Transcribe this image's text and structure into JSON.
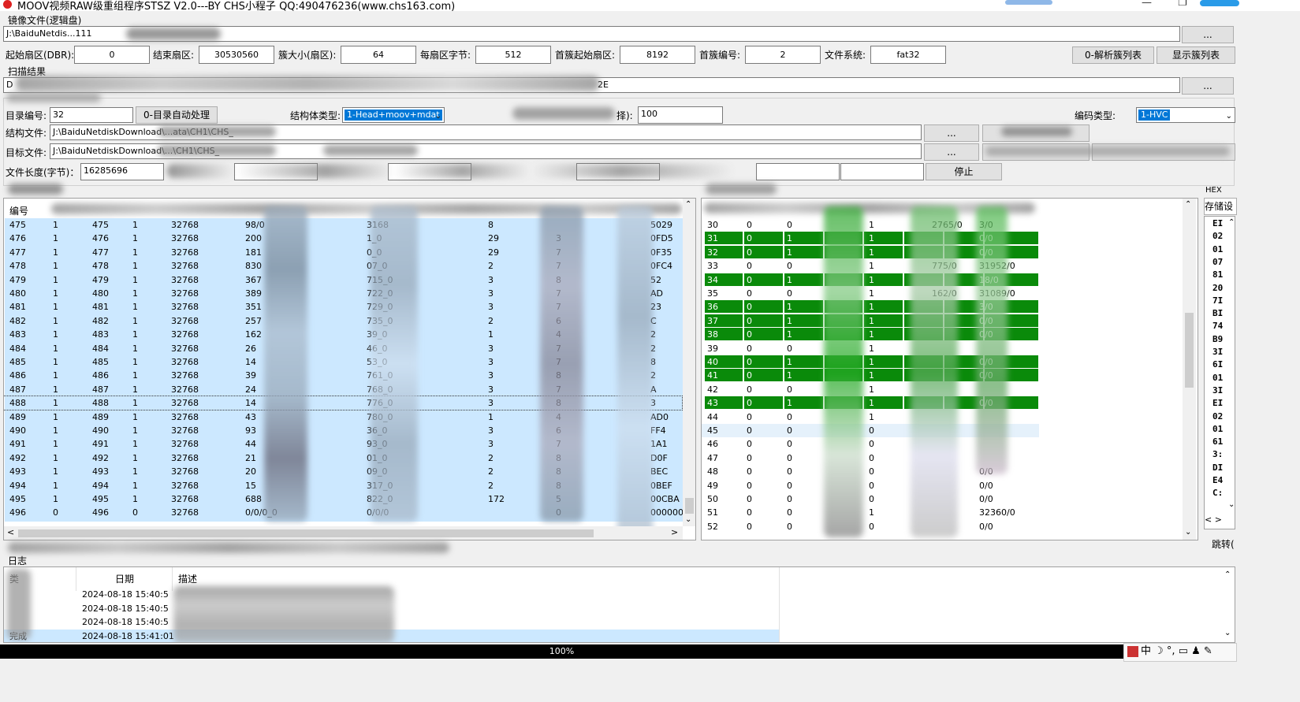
{
  "window": {
    "title": "MOOV视频RAW级重组程序STSZ V2.0---BY CHS小程子  QQ:490476236(www.chs163.com)",
    "minimize": "—",
    "restore": "❐",
    "close": "✕"
  },
  "image_group": {
    "label": "镜像文件(逻辑盘)",
    "path": "J:\\BaiduNetdis...111",
    "browse": "..."
  },
  "params": {
    "start_sector_label": "起始扇区(DBR):",
    "start_sector": "0",
    "end_sector_label": "结束扇区:",
    "end_sector": "30530560",
    "cluster_size_label": "簇大小(扇区):",
    "cluster_size": "64",
    "bytes_per_sector_label": "每扇区字节:",
    "bytes_per_sector": "512",
    "first_cluster_sector_label": "首簇起始扇区:",
    "first_cluster_sector": "8192",
    "first_cluster_no_label": "首簇编号:",
    "first_cluster_no": "2",
    "fs_label": "文件系统:",
    "fs": "fat32",
    "parse_btn": "0-解析簇列表",
    "show_btn": "显示簇列表"
  },
  "scan": {
    "label": "扫描结果",
    "value_prefix": "D",
    "value_suffix": "2E",
    "browse": "..."
  },
  "dir": {
    "dir_no_label": "目录编号:",
    "dir_no": "32",
    "auto_btn": "0-目录自动处理",
    "struct_type_label": "结构体类型:",
    "struct_type": "1-Head+moov+mdat",
    "select_label_suffix": "择):",
    "select_value": "100",
    "codec_label": "编码类型:",
    "codec": "1-HVC",
    "struct_file_label": "结构文件:",
    "struct_file": "J:\\BaiduNetdiskDownload\\...ata\\CH1\\CHS_",
    "target_file_label": "目标文件:",
    "target_file": "J:\\BaiduNetdiskDownload\\...\\CH1\\CHS_",
    "browse1": "...",
    "browse2": "...",
    "file_len_label": "文件长度(字节)：",
    "file_len": "16285696",
    "stop_btn": "停止"
  },
  "left_table": {
    "header_first": "编号",
    "rows": [
      {
        "c": [
          "475",
          "1",
          "475",
          "1",
          "32768",
          "98/0",
          "3168",
          "8",
          "",
          "5029"
        ]
      },
      {
        "c": [
          "476",
          "1",
          "476",
          "1",
          "32768",
          "200",
          "1_0",
          "29",
          "3",
          "0FD5"
        ]
      },
      {
        "c": [
          "477",
          "1",
          "477",
          "1",
          "32768",
          "181",
          "0_0",
          "29",
          "7",
          "0F35"
        ]
      },
      {
        "c": [
          "478",
          "1",
          "478",
          "1",
          "32768",
          "830",
          "07_0",
          "2",
          "7",
          "0FC4"
        ]
      },
      {
        "c": [
          "479",
          "1",
          "479",
          "1",
          "32768",
          "367",
          "715_0",
          "3",
          "8",
          "52"
        ]
      },
      {
        "c": [
          "480",
          "1",
          "480",
          "1",
          "32768",
          "389",
          "722_0",
          "3",
          "7",
          "AD"
        ]
      },
      {
        "c": [
          "481",
          "1",
          "481",
          "1",
          "32768",
          "351",
          "729_0",
          "3",
          "7",
          "23"
        ]
      },
      {
        "c": [
          "482",
          "1",
          "482",
          "1",
          "32768",
          "257",
          "735_0",
          "2",
          "6",
          "C"
        ]
      },
      {
        "c": [
          "483",
          "1",
          "483",
          "1",
          "32768",
          "162",
          "39_0",
          "1",
          "4",
          "2"
        ]
      },
      {
        "c": [
          "484",
          "1",
          "484",
          "1",
          "32768",
          "26",
          "46_0",
          "3",
          "7",
          "2"
        ]
      },
      {
        "c": [
          "485",
          "1",
          "485",
          "1",
          "32768",
          "14",
          "53_0",
          "3",
          "7",
          "8"
        ]
      },
      {
        "c": [
          "486",
          "1",
          "486",
          "1",
          "32768",
          "39",
          "761_0",
          "3",
          "8",
          "2"
        ]
      },
      {
        "c": [
          "487",
          "1",
          "487",
          "1",
          "32768",
          "24",
          "768_0",
          "3",
          "7",
          "A"
        ]
      },
      {
        "c": [
          "488",
          "1",
          "488",
          "1",
          "32768",
          "14",
          "776_0",
          "3",
          "8",
          "3"
        ]
      },
      {
        "c": [
          "489",
          "1",
          "489",
          "1",
          "32768",
          "43",
          "780_0",
          "1",
          "4",
          "AD0"
        ]
      },
      {
        "c": [
          "490",
          "1",
          "490",
          "1",
          "32768",
          "93",
          "36_0",
          "3",
          "6",
          "FF4"
        ]
      },
      {
        "c": [
          "491",
          "1",
          "491",
          "1",
          "32768",
          "44",
          "93_0",
          "3",
          "7",
          "1A1"
        ]
      },
      {
        "c": [
          "492",
          "1",
          "492",
          "1",
          "32768",
          "21",
          "01_0",
          "2",
          "8",
          "D0F"
        ]
      },
      {
        "c": [
          "493",
          "1",
          "493",
          "1",
          "32768",
          "20",
          "09_0",
          "2",
          "8",
          "BEC"
        ]
      },
      {
        "c": [
          "494",
          "1",
          "494",
          "1",
          "32768",
          "15",
          "317_0",
          "2",
          "8",
          "0BEF"
        ]
      },
      {
        "c": [
          "495",
          "1",
          "495",
          "1",
          "32768",
          "688",
          "822_0",
          "172",
          "5",
          "00CBA"
        ]
      },
      {
        "c": [
          "496",
          "0",
          "496",
          "0",
          "32768",
          "0/0/0_0",
          "0/0/0",
          "",
          "0",
          "00000000"
        ]
      }
    ]
  },
  "right_table": {
    "rows": [
      {
        "c": [
          "30",
          "0",
          "0",
          "1",
          "2765/0",
          "3/0"
        ],
        "g": false
      },
      {
        "c": [
          "31",
          "0",
          "1",
          "1",
          "",
          "0/0"
        ],
        "g": true
      },
      {
        "c": [
          "32",
          "0",
          "1",
          "1",
          "",
          "0/0"
        ],
        "g": true
      },
      {
        "c": [
          "33",
          "0",
          "0",
          "1",
          "775/0",
          "31952/0"
        ],
        "g": false
      },
      {
        "c": [
          "34",
          "0",
          "1",
          "1",
          "",
          "18/0"
        ],
        "g": true
      },
      {
        "c": [
          "35",
          "0",
          "0",
          "1",
          "162/0",
          "31089/0"
        ],
        "g": false
      },
      {
        "c": [
          "36",
          "0",
          "1",
          "1",
          "",
          "3/0"
        ],
        "g": true
      },
      {
        "c": [
          "37",
          "0",
          "1",
          "1",
          "",
          "0/0"
        ],
        "g": true
      },
      {
        "c": [
          "38",
          "0",
          "1",
          "1",
          "",
          "0/0"
        ],
        "g": true
      },
      {
        "c": [
          "39",
          "0",
          "0",
          "1",
          "",
          ""
        ],
        "g": false
      },
      {
        "c": [
          "40",
          "0",
          "1",
          "1",
          "",
          "0/0"
        ],
        "g": true
      },
      {
        "c": [
          "41",
          "0",
          "1",
          "1",
          "",
          "0/0"
        ],
        "g": true
      },
      {
        "c": [
          "42",
          "0",
          "0",
          "1",
          "",
          ""
        ],
        "g": false
      },
      {
        "c": [
          "43",
          "0",
          "1",
          "1",
          "",
          "0/0"
        ],
        "g": true
      },
      {
        "c": [
          "44",
          "0",
          "0",
          "1",
          "",
          ""
        ],
        "g": false
      },
      {
        "c": [
          "45",
          "0",
          "0",
          "0",
          "",
          ""
        ],
        "g": false
      },
      {
        "c": [
          "46",
          "0",
          "0",
          "0",
          "",
          ""
        ],
        "g": false
      },
      {
        "c": [
          "47",
          "0",
          "0",
          "0",
          "",
          ""
        ],
        "g": false
      },
      {
        "c": [
          "48",
          "0",
          "0",
          "0",
          "",
          "0/0"
        ],
        "g": false
      },
      {
        "c": [
          "49",
          "0",
          "0",
          "0",
          "",
          "0/0"
        ],
        "g": false
      },
      {
        "c": [
          "50",
          "0",
          "0",
          "0",
          "",
          "0/0"
        ],
        "g": false
      },
      {
        "c": [
          "51",
          "0",
          "0",
          "1",
          "",
          "32360/0"
        ],
        "g": false
      },
      {
        "c": [
          "52",
          "0",
          "0",
          "0",
          "",
          "0/0"
        ],
        "g": false
      }
    ]
  },
  "hex_panel": {
    "label": "HEX",
    "tab": "存储设",
    "lines": [
      "EI",
      "02",
      "01",
      "07",
      "81",
      "20",
      "7I",
      "BI",
      "74",
      "B9",
      "3I",
      "6I",
      "01",
      "3I",
      "EI",
      "02",
      "01",
      "61",
      "3:",
      "DI",
      "E4",
      "C:"
    ],
    "jump": "跳转("
  },
  "log": {
    "label": "日志",
    "col_type": "类",
    "col_date": "日期",
    "col_desc": "描述",
    "rows": [
      {
        "type": "",
        "date": "2024-08-18 15:40:5",
        "desc": ""
      },
      {
        "type": "",
        "date": "2024-08-18 15:40:5",
        "desc": ""
      },
      {
        "type": "",
        "date": "2024-08-18 15:40:5",
        "desc": ""
      },
      {
        "type": "完成",
        "date": "2024-08-18 15:41:01",
        "desc": ""
      }
    ]
  },
  "status": {
    "progress_text": "100%",
    "progress": 1.0
  },
  "ime": {
    "lang": "中"
  }
}
